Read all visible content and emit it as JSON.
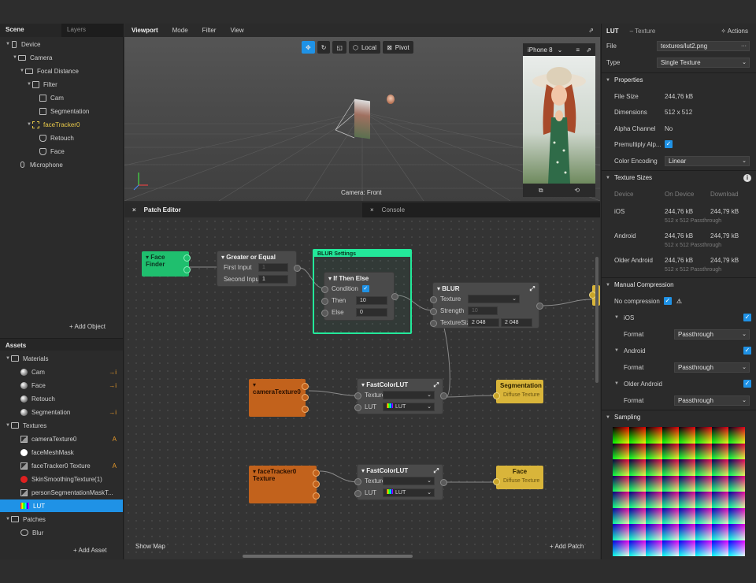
{
  "left": {
    "tabs": [
      "Scene",
      "Layers"
    ],
    "scene_items": [
      {
        "label": "Device",
        "depth": 0,
        "icon": "device-icon"
      },
      {
        "label": "Camera",
        "depth": 1,
        "icon": "camera-icon"
      },
      {
        "label": "Focal Distance",
        "depth": 2,
        "icon": "focal-distance-icon"
      },
      {
        "label": "Filter",
        "depth": 3,
        "icon": "filter-icon"
      },
      {
        "label": "Cam",
        "depth": 4,
        "icon": "plane-icon"
      },
      {
        "label": "Segmentation",
        "depth": 4,
        "icon": "plane-icon"
      },
      {
        "label": "faceTracker0",
        "depth": 3,
        "icon": "face-tracker-icon"
      },
      {
        "label": "Retouch",
        "depth": 4,
        "icon": "face-mesh-icon"
      },
      {
        "label": "Face",
        "depth": 4,
        "icon": "face-mesh-icon"
      },
      {
        "label": "Microphone",
        "depth": 1,
        "icon": "microphone-icon"
      }
    ],
    "add_object": "Add Object",
    "assets_title": "Assets",
    "materials_folder": "Materials",
    "materials": [
      {
        "label": "Cam",
        "flag": "→i"
      },
      {
        "label": "Face",
        "flag": "→i"
      },
      {
        "label": "Retouch",
        "flag": ""
      },
      {
        "label": "Segmentation",
        "flag": "→i"
      }
    ],
    "textures_folder": "Textures",
    "textures": [
      {
        "label": "cameraTexture0",
        "flag": "A"
      },
      {
        "label": "faceMeshMask",
        "flag": ""
      },
      {
        "label": "faceTracker0 Texture",
        "flag": "A"
      },
      {
        "label": "SkinSmoothingTexture(1)",
        "flag": ""
      },
      {
        "label": "personSegmentationMaskT...",
        "flag": ""
      },
      {
        "label": "LUT",
        "flag": ""
      }
    ],
    "patches_folder": "Patches",
    "patches": [
      {
        "label": "Blur"
      }
    ],
    "add_asset": "Add Asset"
  },
  "viewport": {
    "menu": [
      "Viewport",
      "Mode",
      "Filter",
      "View"
    ],
    "local_label": "Local",
    "pivot_label": "Pivot",
    "device": "iPhone 8",
    "camera_label": "Camera: Front"
  },
  "patch_editor": {
    "tab_patch": "Patch Editor",
    "tab_console": "Console",
    "show_map": "Show Map",
    "add_patch": "Add Patch",
    "face_finder": "Face Finder",
    "greater_or_equal": {
      "title": "Greater or Equal",
      "first_input": "First Input",
      "first_val": "1",
      "second_input": "Second Input",
      "second_val": "1"
    },
    "blur_group": "BLUR Settings",
    "if_then_else": {
      "title": "If Then Else",
      "condition": "Condition",
      "then": "Then",
      "then_val": "10",
      "else": "Else",
      "else_val": "0"
    },
    "blur": {
      "title": "BLUR",
      "texture": "Texture",
      "strength": "Strength",
      "strength_val": "10",
      "texture_size": "TextureSize",
      "size_w": "2 048",
      "size_h": "2 048"
    },
    "camera_texture": "cameraTexture0",
    "face_tracker_texture": "faceTracker0 Texture",
    "fast_lut_1": {
      "title": "FastColorLUT",
      "texture": "Texture",
      "lut": "LUT",
      "lut_val": "LUT"
    },
    "fast_lut_2": {
      "title": "FastColorLUT",
      "texture": "Texture",
      "lut": "LUT",
      "lut_val": "LUT"
    },
    "segmentation": {
      "title": "Segmentation",
      "port": "Diffuse Texture"
    },
    "face": {
      "title": "Face",
      "port": "Diffuse Texture"
    }
  },
  "right": {
    "title": "LUT",
    "subtitle": "– Texture",
    "actions": "Actions",
    "file_label": "File",
    "file_value": "textures/lut2.png",
    "type_label": "Type",
    "type_value": "Single Texture",
    "properties_title": "Properties",
    "properties": [
      {
        "label": "File Size",
        "value": "244,76 kB"
      },
      {
        "label": "Dimensions",
        "value": "512 x 512"
      },
      {
        "label": "Alpha Channel",
        "value": "No"
      }
    ],
    "premultiply_label": "Premultiply Alp...",
    "color_encoding_label": "Color Encoding",
    "color_encoding_value": "Linear",
    "texture_sizes_title": "Texture Sizes",
    "ts_headers": [
      "Device",
      "On Device",
      "Download"
    ],
    "ts_rows": [
      {
        "device": "iOS",
        "on_device": "244,76 kB",
        "download": "244,79 kB",
        "note": "512 x 512 Passthrough"
      },
      {
        "device": "Android",
        "on_device": "244,76 kB",
        "download": "244,79 kB",
        "note": "512 x 512 Passthrough"
      },
      {
        "device": "Older Android",
        "on_device": "244,76 kB",
        "download": "244,79 kB",
        "note": "512 x 512 Passthrough"
      }
    ],
    "manual_compression_title": "Manual Compression",
    "no_compression_label": "No compression",
    "ios_label": "iOS",
    "android_label": "Android",
    "older_android_label": "Older Android",
    "format_label": "Format",
    "format_value": "Passthrough",
    "sampling_title": "Sampling"
  },
  "colors": {
    "accent": "#1f92e6",
    "green_node": "#1fbf6e",
    "orange_node": "#c2621c",
    "yellow_node": "#d9b53a",
    "blur_group": "#23e89a"
  }
}
